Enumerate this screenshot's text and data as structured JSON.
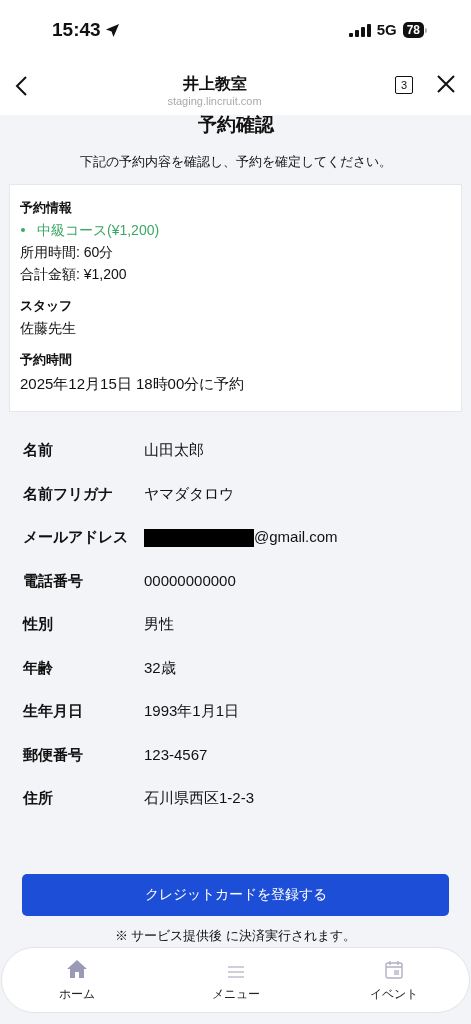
{
  "status_bar": {
    "time": "15:43",
    "network": "5G",
    "battery": "78"
  },
  "header": {
    "title": "井上教室",
    "url": "staging.lincruit.com",
    "tab_count": "3"
  },
  "page": {
    "title": "予約確認",
    "subtitle": "下記の予約内容を確認し、予約を確定してください。"
  },
  "summary": {
    "sections": [
      {
        "heading": "予約情報",
        "lines": [
          {
            "kind": "course",
            "text": "中級コース(¥1,200)"
          },
          {
            "kind": "plain",
            "text": "所用時間: 60分"
          },
          {
            "kind": "plain",
            "text": "合計金額: ¥1,200"
          }
        ]
      },
      {
        "heading": "スタッフ",
        "lines": [
          {
            "kind": "plain",
            "text": "佐藤先生"
          }
        ]
      },
      {
        "heading": "予約時間",
        "lines": [
          {
            "kind": "large",
            "text": "2025年12月15日 18時00分に予約"
          }
        ]
      }
    ]
  },
  "details": [
    {
      "label": "名前",
      "value": "山田太郎",
      "redacted": false
    },
    {
      "label": "名前フリガナ",
      "value": "ヤマダタロウ",
      "redacted": false
    },
    {
      "label": "メールアドレス",
      "value": "@gmail.com",
      "redacted": true
    },
    {
      "label": "電話番号",
      "value": "00000000000",
      "redacted": false
    },
    {
      "label": "性別",
      "value": "男性",
      "redacted": false
    },
    {
      "label": "年齢",
      "value": "32歳",
      "redacted": false
    },
    {
      "label": "生年月日",
      "value": "1993年1月1日",
      "redacted": false
    },
    {
      "label": "郵便番号",
      "value": "123-4567",
      "redacted": false
    },
    {
      "label": "住所",
      "value": "石川県西区1-2-3",
      "redacted": false
    }
  ],
  "submit_button": "クレジットカードを登録する",
  "note": "※ サービス提供後 に決済実行されます。",
  "bottom_nav": [
    {
      "kind": "home",
      "label": "ホーム"
    },
    {
      "kind": "menu",
      "label": "メニュー"
    },
    {
      "kind": "event",
      "label": "イベント"
    }
  ]
}
